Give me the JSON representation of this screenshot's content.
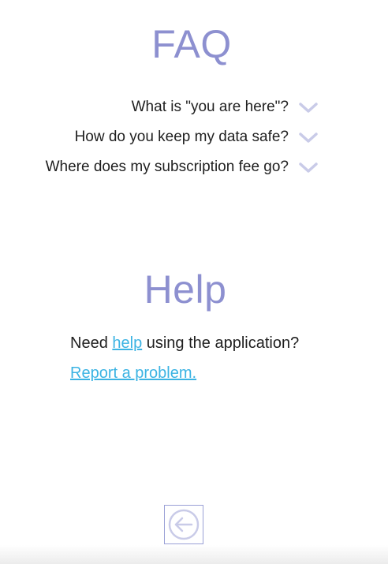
{
  "faq": {
    "title": "FAQ",
    "items": [
      {
        "question": "What is \"you are here\"?",
        "icon": "chevron-down-icon"
      },
      {
        "question": "How do you keep my data safe?",
        "icon": "chevron-down-icon"
      },
      {
        "question": "Where does my subscription fee go?",
        "icon": "chevron-down-icon"
      }
    ]
  },
  "help": {
    "title": "Help",
    "need_prefix": "Need ",
    "help_link": "help",
    "need_suffix": " using the application?",
    "report_link": "Report a problem."
  },
  "navigation": {
    "back_icon": "arrow-left-circle-icon"
  },
  "colors": {
    "title": "#8d90d0",
    "chevron": "#c9cbe8",
    "link": "#3bb3e3",
    "text": "#1f1f1f",
    "back_border": "#9aa0d6"
  }
}
